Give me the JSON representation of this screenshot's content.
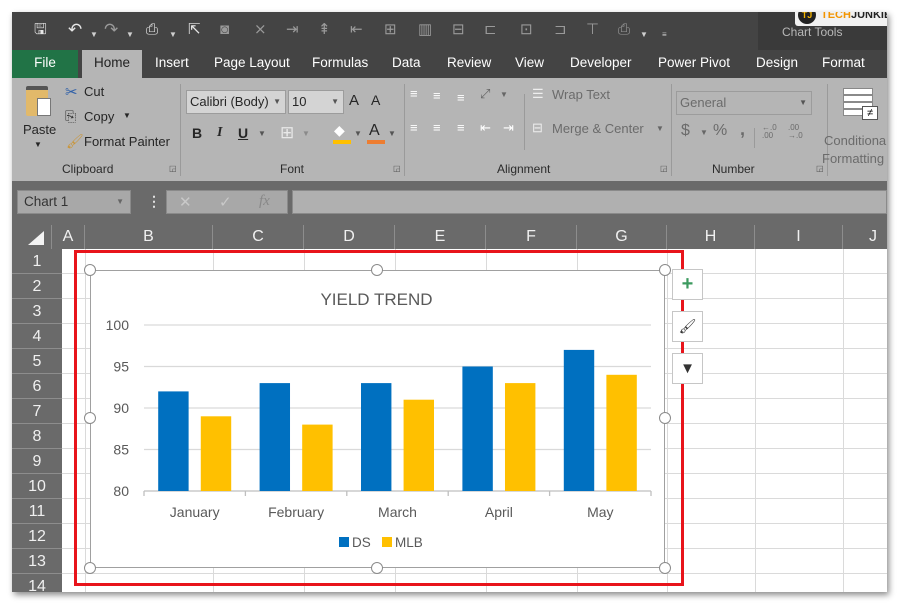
{
  "quick_access": {
    "icons": [
      "save-icon",
      "undo-icon",
      "redo-icon",
      "print-preview-icon",
      "select-objects-icon",
      "camera-icon",
      "delete-columns-icon",
      "delete-rows-icon",
      "insert-columns-icon",
      "insert-rows-icon",
      "merge-icon",
      "chart-icon",
      "align-center-icon",
      "align-left-icon",
      "distribute-icon",
      "align-right-icon",
      "align-top-icon",
      "print-icon",
      "customize-icon"
    ]
  },
  "contextual": {
    "label": "Chart Tools"
  },
  "watermark": {
    "badge": "TJ",
    "brand_a": "TECH",
    "brand_b": "JUNKIE"
  },
  "tabs": [
    {
      "label": "File"
    },
    {
      "label": "Home"
    },
    {
      "label": "Insert"
    },
    {
      "label": "Page Layout"
    },
    {
      "label": "Formulas"
    },
    {
      "label": "Data"
    },
    {
      "label": "Review"
    },
    {
      "label": "View"
    },
    {
      "label": "Developer"
    },
    {
      "label": "Power Pivot"
    },
    {
      "label": "Design"
    },
    {
      "label": "Format"
    }
  ],
  "ribbon": {
    "clipboard": {
      "paste": "Paste",
      "cut": "Cut",
      "copy": "Copy",
      "format_painter": "Format Painter",
      "group_label": "Clipboard"
    },
    "font": {
      "font_name": "Calibri (Body)",
      "font_size": "10",
      "bold": "B",
      "italic": "I",
      "underline": "U",
      "grow": "A",
      "shrink": "A",
      "font_color_glyph": "A",
      "fill_color": "#ffc000",
      "font_color": "#ed7d31",
      "group_label": "Font"
    },
    "alignment": {
      "wrap_text": "Wrap Text",
      "merge_center": "Merge & Center",
      "group_label": "Alignment"
    },
    "number": {
      "format": "General",
      "currency": "$",
      "percent": "%",
      "comma": ",",
      "inc_decimal": "←.0 .00",
      "dec_decimal": ".00 →.0",
      "group_label": "Number"
    },
    "styles": {
      "conditional_1": "Conditional",
      "conditional_2": "Formatting"
    }
  },
  "formula_bar": {
    "name_box": "Chart 1",
    "cancel": "✕",
    "enter": "✓",
    "fx": "fx",
    "value": ""
  },
  "columns": [
    "A",
    "B",
    "C",
    "D",
    "E",
    "F",
    "G",
    "H",
    "I",
    "J"
  ],
  "rows": [
    "1",
    "2",
    "3",
    "4",
    "5",
    "6",
    "7",
    "8",
    "9",
    "10",
    "11",
    "12",
    "13",
    "14"
  ],
  "chart_side_buttons": [
    {
      "name": "chart-elements-button",
      "glyph": "+"
    },
    {
      "name": "chart-styles-button",
      "glyph": "🖌"
    },
    {
      "name": "chart-filters-button",
      "glyph": "▼"
    }
  ],
  "chart_data": {
    "type": "bar",
    "title": "YIELD TREND",
    "categories": [
      "January",
      "February",
      "March",
      "April",
      "May"
    ],
    "series": [
      {
        "name": "DS",
        "color": "#0070c0",
        "values": [
          92,
          93,
          93,
          95,
          97
        ]
      },
      {
        "name": "MLB",
        "color": "#ffc000",
        "values": [
          89,
          88,
          91,
          93,
          94
        ]
      }
    ],
    "xlabel": "",
    "ylabel": "",
    "ylim": [
      80,
      100
    ],
    "yticks": [
      80,
      85,
      90,
      95,
      100
    ],
    "grid": true,
    "legend": "bottom"
  }
}
